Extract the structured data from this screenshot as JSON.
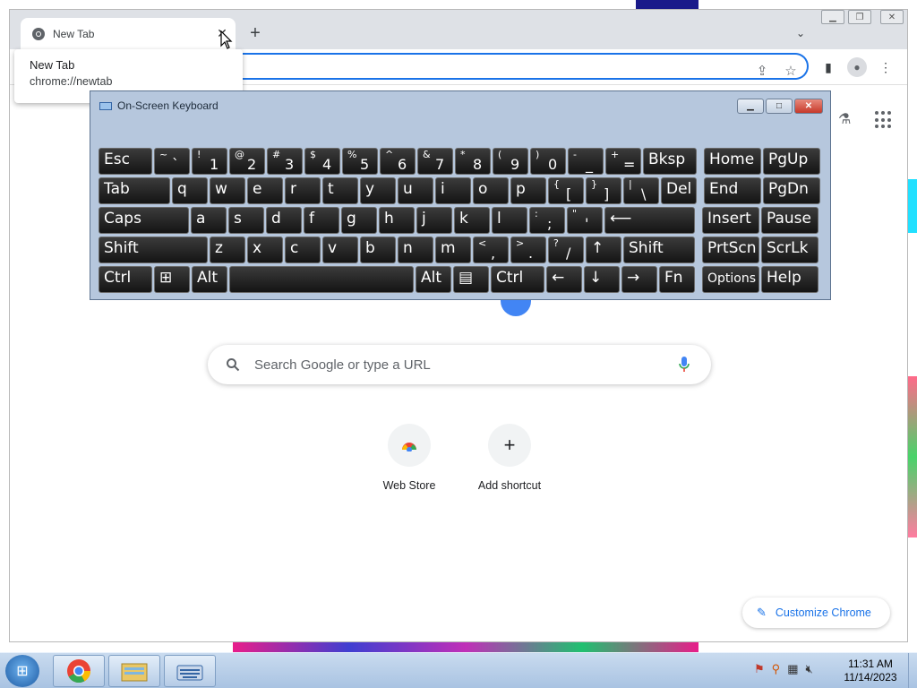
{
  "browser": {
    "tab_title": "New Tab",
    "tooltip_title": "New Tab",
    "tooltip_url": "chrome://newtab",
    "new_tab_symbol": "+",
    "close_symbol": "✕"
  },
  "newtab_page": {
    "search_placeholder": "Search Google or type a URL",
    "shortcuts": [
      {
        "label": "Web Store",
        "icon": "chrome-web-store-icon"
      },
      {
        "label": "Add shortcut",
        "icon": "plus-icon",
        "symbol": "+"
      }
    ],
    "customize_label": "Customize Chrome"
  },
  "osk": {
    "title": "On-Screen Keyboard",
    "rows": [
      [
        {
          "m": "Esc"
        },
        {
          "up": "~",
          "lo": "`"
        },
        {
          "up": "!",
          "lo": "1"
        },
        {
          "up": "@",
          "lo": "2"
        },
        {
          "up": "#",
          "lo": "3"
        },
        {
          "up": "$",
          "lo": "4"
        },
        {
          "up": "%",
          "lo": "5"
        },
        {
          "up": "^",
          "lo": "6"
        },
        {
          "up": "&",
          "lo": "7"
        },
        {
          "up": "*",
          "lo": "8"
        },
        {
          "up": "(",
          "lo": "9"
        },
        {
          "up": ")",
          "lo": "0"
        },
        {
          "up": "-",
          "lo": "_"
        },
        {
          "up": "+",
          "lo": "="
        },
        {
          "m": "Bksp"
        },
        {
          "m": "Home"
        },
        {
          "m": "PgUp"
        }
      ],
      [
        {
          "m": "Tab"
        },
        {
          "m": "q"
        },
        {
          "m": "w"
        },
        {
          "m": "e"
        },
        {
          "m": "r"
        },
        {
          "m": "t"
        },
        {
          "m": "y"
        },
        {
          "m": "u"
        },
        {
          "m": "i"
        },
        {
          "m": "o"
        },
        {
          "m": "p"
        },
        {
          "up": "{",
          "lo": "["
        },
        {
          "up": "}",
          "lo": "]"
        },
        {
          "up": "|",
          "lo": "\\"
        },
        {
          "m": "Del"
        },
        {
          "m": "End"
        },
        {
          "m": "PgDn"
        }
      ],
      [
        {
          "m": "Caps"
        },
        {
          "m": "a"
        },
        {
          "m": "s"
        },
        {
          "m": "d"
        },
        {
          "m": "f"
        },
        {
          "m": "g"
        },
        {
          "m": "h"
        },
        {
          "m": "j"
        },
        {
          "m": "k"
        },
        {
          "m": "l"
        },
        {
          "up": ":",
          "lo": ";"
        },
        {
          "up": "\"",
          "lo": "'"
        },
        {
          "m": "⟵"
        },
        {
          "m": "Insert"
        },
        {
          "m": "Pause"
        }
      ],
      [
        {
          "m": "Shift"
        },
        {
          "m": "z"
        },
        {
          "m": "x"
        },
        {
          "m": "c"
        },
        {
          "m": "v"
        },
        {
          "m": "b"
        },
        {
          "m": "n"
        },
        {
          "m": "m"
        },
        {
          "up": "<",
          "lo": ","
        },
        {
          "up": ">",
          "lo": "."
        },
        {
          "up": "?",
          "lo": "/"
        },
        {
          "m": "↑"
        },
        {
          "m": "Shift"
        },
        {
          "m": "PrtScn"
        },
        {
          "m": "ScrLk"
        }
      ],
      [
        {
          "m": "Ctrl"
        },
        {
          "m": "⊞"
        },
        {
          "m": "Alt"
        },
        {
          "m": ""
        },
        {
          "m": "Alt"
        },
        {
          "m": "▤"
        },
        {
          "m": "Ctrl"
        },
        {
          "m": "←"
        },
        {
          "m": "↓"
        },
        {
          "m": "→"
        },
        {
          "m": "Fn"
        },
        {
          "sm": "Options"
        },
        {
          "m": "Help"
        }
      ]
    ]
  },
  "taskbar": {
    "time": "11:31 AM",
    "date": "11/14/2023"
  },
  "colors": {
    "accent": "#1a73e8",
    "osk_bg": "#b6c7dd",
    "key_bg": "#1f1f1f"
  }
}
